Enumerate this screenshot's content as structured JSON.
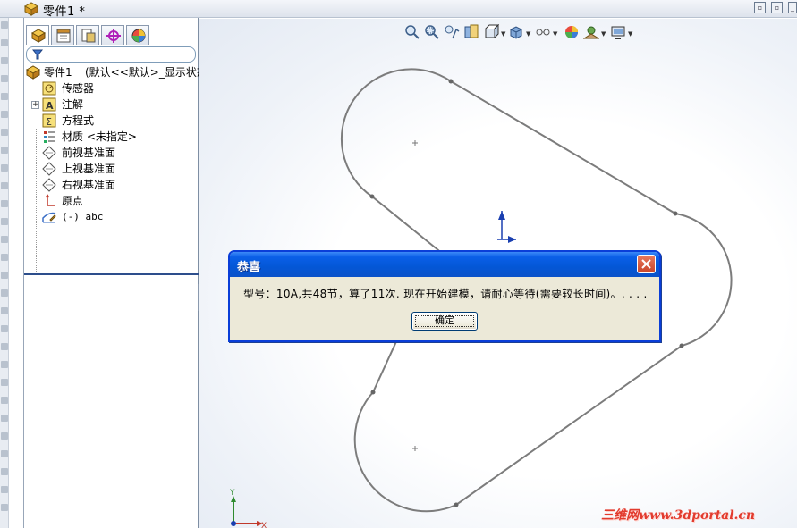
{
  "window": {
    "document_title": "零件1",
    "modified_marker": "*"
  },
  "feature_tree": {
    "tabs": [
      "feature-manager",
      "property-manager",
      "configuration-manager",
      "dimxpert-manager",
      "display-manager"
    ],
    "root": {
      "label": "零件1",
      "state_text": "(默认<<默认>_显示状态"
    },
    "items": [
      {
        "label": "传感器",
        "icon": "sensor-icon"
      },
      {
        "label": "注解",
        "icon": "annotation-icon"
      },
      {
        "label": "方程式",
        "icon": "equations-icon"
      },
      {
        "label": "材质 <未指定>",
        "icon": "material-icon"
      },
      {
        "label": "前视基准面",
        "icon": "plane-icon"
      },
      {
        "label": "上视基准面",
        "icon": "plane-icon"
      },
      {
        "label": "右视基准面",
        "icon": "plane-icon"
      },
      {
        "label": "原点",
        "icon": "origin-icon"
      },
      {
        "label": "(-) abc",
        "icon": "sketch-icon"
      }
    ]
  },
  "dialog": {
    "title": "恭喜",
    "message": "型号：10A,共48节，算了11次. 现在开始建模，请耐心等待(需要较长时间)。. . . .",
    "ok_label": "确定"
  },
  "triad": {
    "y_label": "Y",
    "x_label": "X"
  },
  "watermark": "三维网www.3dportal.cn",
  "colors": {
    "dialog_title_blue": "#0457d6",
    "close_button_red": "#c9452a",
    "watermark_red": "#e23b2e",
    "tree_divider": "#2d4e8c"
  }
}
